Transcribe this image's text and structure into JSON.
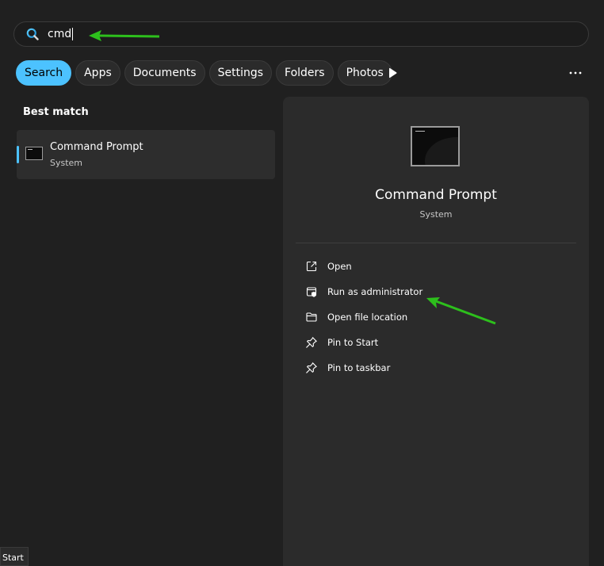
{
  "search": {
    "query": "cmd"
  },
  "filters": [
    {
      "label": "Search",
      "active": true
    },
    {
      "label": "Apps",
      "active": false
    },
    {
      "label": "Documents",
      "active": false
    },
    {
      "label": "Settings",
      "active": false
    },
    {
      "label": "Folders",
      "active": false
    },
    {
      "label": "Photos",
      "active": false
    }
  ],
  "results": {
    "section_title": "Best match",
    "best": {
      "title": "Command Prompt",
      "subtitle": "System",
      "icon": "command-prompt-icon"
    }
  },
  "details": {
    "title": "Command Prompt",
    "subtitle": "System",
    "actions": [
      {
        "label": "Open",
        "icon": "open-external-icon"
      },
      {
        "label": "Run as administrator",
        "icon": "shield-icon"
      },
      {
        "label": "Open file location",
        "icon": "folder-icon"
      },
      {
        "label": "Pin to Start",
        "icon": "pin-icon"
      },
      {
        "label": "Pin to taskbar",
        "icon": "pin-icon"
      }
    ]
  },
  "tooltip": {
    "label": "Start"
  },
  "colors": {
    "accent": "#4cc2ff",
    "annotation_arrow": "#2dbf1c",
    "background": "#202020",
    "panel": "#2b2b2b"
  }
}
